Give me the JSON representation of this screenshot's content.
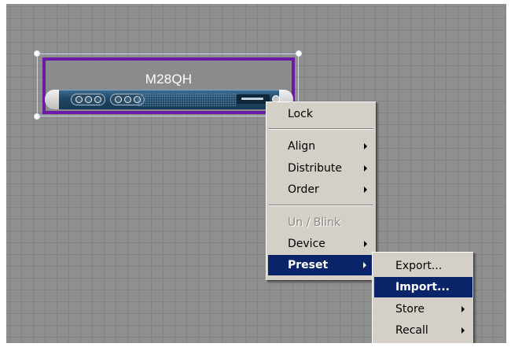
{
  "device": {
    "name": "M28QH",
    "icons": [
      "knob-group-icon",
      "knob-group-icon",
      "speaker-grille",
      "logo-plate",
      "power-indicator-icon"
    ]
  },
  "context_menu": {
    "items": [
      {
        "label": "Lock",
        "has_submenu": false,
        "enabled": true
      },
      {
        "label": "Align",
        "has_submenu": true,
        "enabled": true
      },
      {
        "label": "Distribute",
        "has_submenu": true,
        "enabled": true
      },
      {
        "label": "Order",
        "has_submenu": true,
        "enabled": true
      },
      {
        "label": "Un / Blink",
        "has_submenu": false,
        "enabled": false
      },
      {
        "label": "Device",
        "has_submenu": true,
        "enabled": true
      },
      {
        "label": "Preset",
        "has_submenu": true,
        "enabled": true,
        "highlighted": true
      }
    ]
  },
  "preset_submenu": {
    "items": [
      {
        "label": "Export...",
        "has_submenu": false
      },
      {
        "label": "Import...",
        "has_submenu": false,
        "highlighted": true
      },
      {
        "label": "Store",
        "has_submenu": true
      },
      {
        "label": "Recall",
        "has_submenu": true
      }
    ]
  },
  "colors": {
    "canvas_bg": "#8f8f8f",
    "grid_line": "#828282",
    "device_border": "#6a1aa5",
    "menu_bg": "#d4d0c8",
    "highlight": "#0a246a"
  }
}
